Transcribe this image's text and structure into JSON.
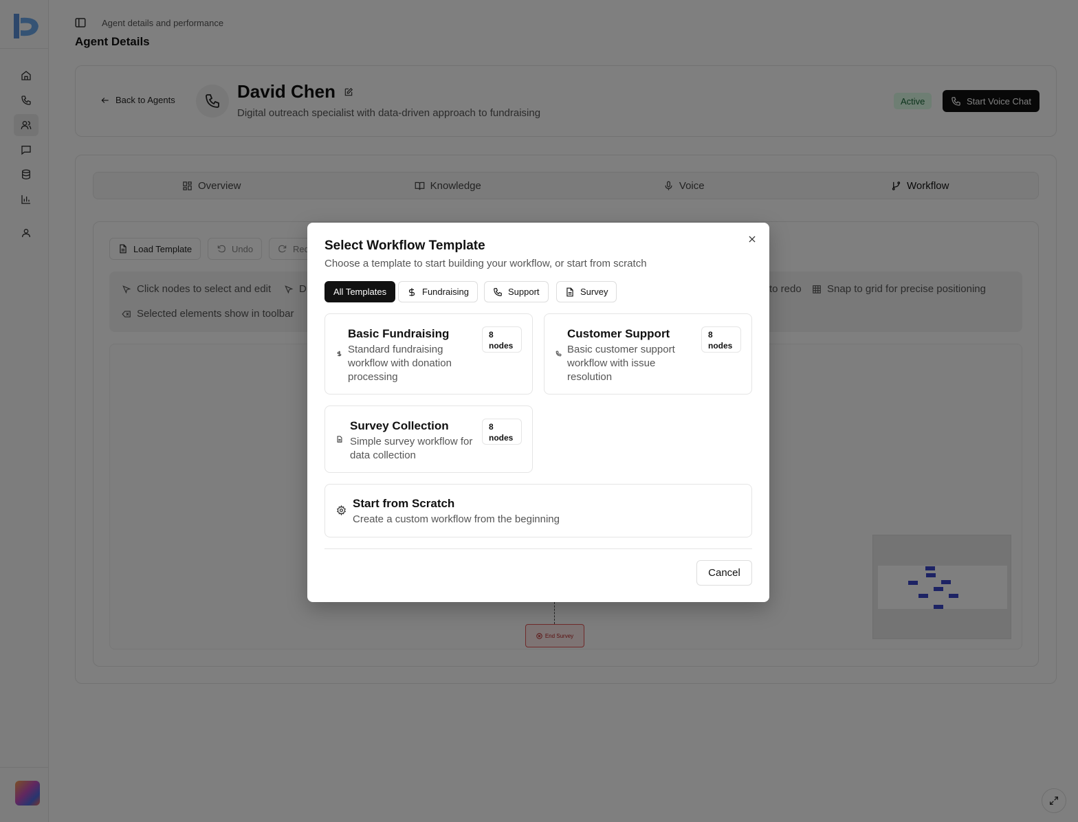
{
  "header": {
    "breadcrumb": "Agent details and performance",
    "title": "Agent Details"
  },
  "sidebar": {
    "items": [
      {
        "icon": "home-icon"
      },
      {
        "icon": "phone-icon"
      },
      {
        "icon": "users-icon",
        "active": true
      },
      {
        "icon": "message-icon"
      },
      {
        "icon": "database-icon"
      },
      {
        "icon": "bar-chart-icon"
      },
      {
        "icon": "user-icon"
      }
    ]
  },
  "agent": {
    "back_label": "Back to Agents",
    "name": "David Chen",
    "description": "Digital outreach specialist with data-driven approach to fundraising",
    "status": "Active",
    "voice_chat_label": "Start Voice Chat"
  },
  "tabs": [
    {
      "label": "Overview",
      "icon": "grid-icon"
    },
    {
      "label": "Knowledge",
      "icon": "book-icon"
    },
    {
      "label": "Voice",
      "icon": "mic-icon"
    },
    {
      "label": "Workflow",
      "icon": "git-branch-icon",
      "active": true
    }
  ],
  "toolbar": {
    "load_template": "Load Template",
    "undo": "Undo",
    "redo": "Redo"
  },
  "tips": {
    "select": "Click nodes to select and edit",
    "drag": "Drag",
    "redo": "to redo",
    "snap": "Snap to grid for precise positioning",
    "selected": "Selected elements show in toolbar"
  },
  "canvas": {
    "end_node_label": "End Survey"
  },
  "modal": {
    "title": "Select Workflow Template",
    "subtitle": "Choose a template to start building your workflow, or start from scratch",
    "filters": [
      {
        "label": "All Templates",
        "active": true
      },
      {
        "label": "Fundraising",
        "icon": "dollar-icon"
      },
      {
        "label": "Support",
        "icon": "phone-icon"
      },
      {
        "label": "Survey",
        "icon": "file-icon"
      }
    ],
    "templates": [
      {
        "name": "Basic Fundraising",
        "description": "Standard fundraising workflow with donation processing",
        "nodes_count": "8",
        "nodes_unit": "nodes",
        "icon": "dollar-icon"
      },
      {
        "name": "Customer Support",
        "description": "Basic customer support workflow with issue resolution",
        "nodes_count": "8",
        "nodes_unit": "nodes",
        "icon": "phone-icon"
      },
      {
        "name": "Survey Collection",
        "description": "Simple survey workflow for data collection",
        "nodes_count": "8",
        "nodes_unit": "nodes",
        "icon": "file-icon"
      }
    ],
    "scratch": {
      "title": "Start from Scratch",
      "description": "Create a custom workflow from the beginning",
      "icon": "gear-icon"
    },
    "cancel_label": "Cancel"
  },
  "colors": {
    "accent": "#111111",
    "status_bg": "#dcfce7",
    "status_text": "#166534",
    "end_node": "#e05555",
    "minimap_node": "#3a47c8"
  }
}
